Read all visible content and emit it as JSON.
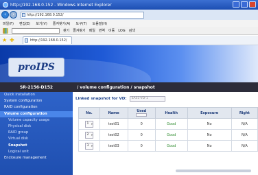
{
  "window": {
    "title": "http://192.168.0.152 - Windows Internet Explorer"
  },
  "address": {
    "url": "http://192.168.0.152/"
  },
  "menu": {
    "items": [
      "파일(F)",
      "편집(E)",
      "보기(V)",
      "즐겨찾기(A)",
      "도구(T)",
      "도움말(H)"
    ]
  },
  "toolbar": {
    "items": [
      "찾기",
      "즐겨찾기",
      "메일",
      "번역",
      "이동",
      "LOG",
      "검색"
    ]
  },
  "favbar": {
    "tab_title": "http://192.168.0.152/"
  },
  "header": {
    "logo_text": "proIPS"
  },
  "strip": {
    "host": "SR-2156-D152",
    "path": "/ volume configuration / snapshot"
  },
  "sidebar": {
    "items": [
      {
        "label": "Quick installation"
      },
      {
        "label": "System configuration"
      },
      {
        "label": "RAID configuration"
      },
      {
        "label": "Volume configuration"
      },
      {
        "label": "Volume capacity usage"
      },
      {
        "label": "Physical disk"
      },
      {
        "label": "RAID group"
      },
      {
        "label": "Virtual disk"
      },
      {
        "label": "Snapshot"
      },
      {
        "label": "Logical unit"
      },
      {
        "label": "Enclosure management"
      }
    ]
  },
  "main": {
    "linked_label": "Linked snapshot for VD:",
    "linked_select": "SAS1-VD-1",
    "columns": [
      "No.",
      "Name",
      "Used",
      "Health",
      "Exposure",
      "Right"
    ],
    "rows": [
      {
        "no": "1",
        "name": "test01",
        "used": "0",
        "health": "Good",
        "exposure": "No",
        "right": "N/A"
      },
      {
        "no": "2",
        "name": "test02",
        "used": "0",
        "health": "Good",
        "exposure": "No",
        "right": "N/A"
      },
      {
        "no": "3",
        "name": "test03",
        "used": "0",
        "health": "Good",
        "exposure": "No",
        "right": "N/A"
      }
    ]
  }
}
